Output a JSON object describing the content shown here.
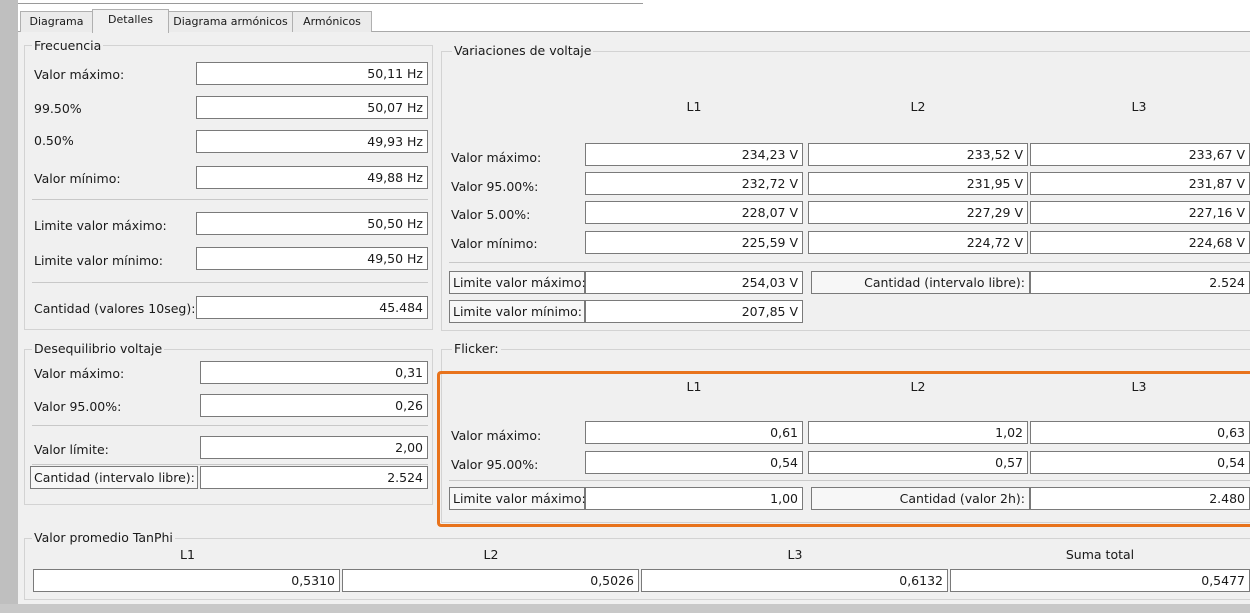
{
  "tabs": [
    {
      "label": "Diagrama"
    },
    {
      "label": "Detalles"
    },
    {
      "label": "Diagrama armónicos"
    },
    {
      "label": "Armónicos"
    }
  ],
  "frecuencia": {
    "title": "Frecuencia",
    "valor_maximo": {
      "label": "Valor máximo:",
      "value": "50,11 Hz"
    },
    "p9950": {
      "label": "99.50%",
      "value": "50,07 Hz"
    },
    "p050": {
      "label": "0.50%",
      "value": "49,93 Hz"
    },
    "valor_minimo": {
      "label": "Valor mínimo:",
      "value": "49,88 Hz"
    },
    "limite_maximo": {
      "label": "Limite valor máximo:",
      "value": "50,50 Hz"
    },
    "limite_minimo": {
      "label": "Limite valor mínimo:",
      "value": "49,50 Hz"
    },
    "cantidad": {
      "label": "Cantidad (valores 10seg):",
      "value": "45.484"
    }
  },
  "variaciones": {
    "title": "Variaciones de voltaje",
    "headers": [
      "L1",
      "L2",
      "L3"
    ],
    "rows": [
      {
        "label": "Valor máximo:",
        "values": [
          "234,23 V",
          "233,52 V",
          "233,67 V"
        ]
      },
      {
        "label": "Valor 95.00%:",
        "values": [
          "232,72 V",
          "231,95 V",
          "231,87 V"
        ]
      },
      {
        "label": "Valor 5.00%:",
        "values": [
          "228,07 V",
          "227,29 V",
          "227,16 V"
        ]
      },
      {
        "label": "Valor mínimo:",
        "values": [
          "225,59 V",
          "224,72 V",
          "224,68 V"
        ]
      }
    ],
    "limite_maximo": {
      "label": "Limite valor máximo:",
      "value": "254,03 V"
    },
    "limite_minimo": {
      "label": "Limite valor mínimo:",
      "value": "207,85 V"
    },
    "cantidad": {
      "label": "Cantidad (intervalo libre):",
      "value": "2.524"
    }
  },
  "desequilibrio": {
    "title": "Desequilibrio voltaje",
    "valor_maximo": {
      "label": "Valor máximo:",
      "value": "0,31"
    },
    "valor_95": {
      "label": "Valor 95.00%:",
      "value": "0,26"
    },
    "valor_limite": {
      "label": "Valor límite:",
      "value": "2,00"
    },
    "cantidad": {
      "label": "Cantidad (intervalo libre):",
      "value": "2.524"
    }
  },
  "flicker": {
    "title": "Flicker:",
    "headers": [
      "L1",
      "L2",
      "L3"
    ],
    "rows": [
      {
        "label": "Valor máximo:",
        "values": [
          "0,61",
          "1,02",
          "0,63"
        ]
      },
      {
        "label": "Valor 95.00%:",
        "values": [
          "0,54",
          "0,57",
          "0,54"
        ]
      }
    ],
    "limite_maximo": {
      "label": "Limite valor máximo:",
      "value": "1,00"
    },
    "cantidad": {
      "label": "Cantidad (valor 2h):",
      "value": "2.480"
    }
  },
  "tanphi": {
    "title": "Valor promedio TanPhi",
    "headers": [
      "L1",
      "L2",
      "L3",
      "Suma total"
    ],
    "values": [
      "0,5310",
      "0,5026",
      "0,6132",
      "0,5477"
    ]
  },
  "colors": {
    "highlight": "#e8731c",
    "panel": "#f0f0f0",
    "field_border": "#7a7a7a"
  }
}
